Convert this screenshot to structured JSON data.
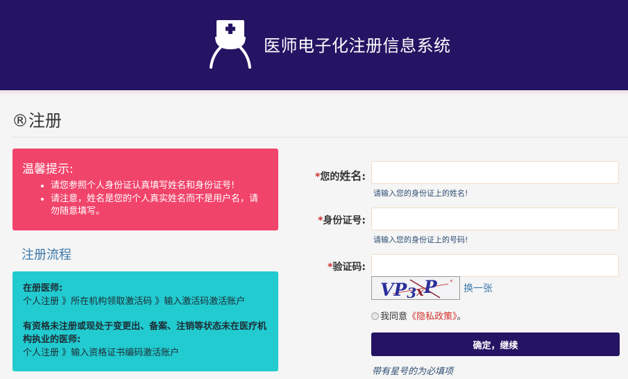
{
  "header": {
    "app_title": "医师电子化注册信息系统",
    "logo_icon": "doctor-nurse-cap-icon",
    "background_color": "#241463"
  },
  "page": {
    "title": "®注册"
  },
  "tips": {
    "heading": "温馨提示:",
    "items": [
      "请您参照个人身份证认真填写姓名和身份证号!",
      "请注意，姓名是您的个人真实姓名而不是用户名，请勿随意填写。"
    ],
    "background_color": "#f1446b"
  },
  "flow": {
    "title": "注册流程",
    "blocks": [
      {
        "heading": "在册医师:",
        "steps": "个人注册 》所在机构领取激活码 》输入激活码激活账户"
      },
      {
        "heading": "有资格未注册或现处于变更出、备案、注销等状态未在医疗机构执业的医师:",
        "steps": "个人注册 》输入资格证书编码激活账户"
      }
    ],
    "background_color": "#22cbd0"
  },
  "form": {
    "required_mark": "*",
    "name": {
      "label_prefix": "您的",
      "label_main": "姓名",
      "label_suffix": ":",
      "value": "",
      "hint": "请输入您的身份证上的姓名!"
    },
    "id_number": {
      "label": "身份证号:",
      "value": "",
      "hint": "请输入您的身份证上的号码!"
    },
    "captcha": {
      "label": "验证码:",
      "value": "",
      "image_text": "VP3xP",
      "refresh_label": "换一张"
    },
    "agreement": {
      "prefix": "我同意",
      "policy_link": "《隐私政策》",
      "suffix": "。",
      "checked": false
    },
    "submit_label": "确定，继续",
    "required_note": "带有星号的为必填项"
  }
}
